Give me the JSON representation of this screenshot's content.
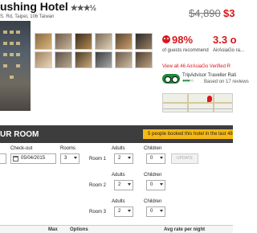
{
  "hotel": {
    "name": "ushing Hotel",
    "stars": "★★★½",
    "address": "S. Rd, Taipei, 106 Taiwan"
  },
  "pricing": {
    "old_price": "$4,890",
    "new_price": "$3"
  },
  "recommend": {
    "percent": "98%",
    "label": "of guests recommend"
  },
  "airasiago": {
    "score": "3.3 o",
    "label": "AirAsiaGo ra..."
  },
  "reviews_link": "View all 46 AirAsiaGo Verified R",
  "tripadvisor": {
    "label": "TripAdvisor Traveller Rati",
    "dots": "●●●◐○",
    "reviews": "Based on 17 reviews"
  },
  "section": {
    "title": "UR ROOM",
    "urgency": "5 people booked this hotel in the last 48"
  },
  "form": {
    "checkout_label": "Check-out",
    "checkout_value": "05/04/2015",
    "rooms_label": "Rooms",
    "rooms_value": "3",
    "adults_label": "Adults",
    "children_label": "Children",
    "update_label": "UPDATE",
    "rooms": [
      {
        "label": "Room 1",
        "adults": "2",
        "children": "0"
      },
      {
        "label": "Room 2",
        "adults": "2",
        "children": "0"
      },
      {
        "label": "Room 3",
        "adults": "2",
        "children": "0"
      }
    ]
  },
  "table": {
    "headers": [
      "Max",
      "Options",
      "Avg rate per night"
    ]
  },
  "colors": {
    "accent_red": "#d9161c",
    "bar_dark": "#3d3d3d",
    "badge_yellow": "#f7b915",
    "tripadvisor_green": "#1d8a3a"
  }
}
